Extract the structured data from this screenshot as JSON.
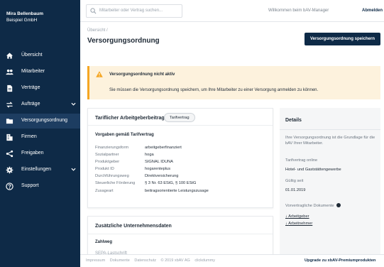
{
  "org": {
    "name": "Mira Bellenbaum",
    "company": "Beispiel GmbH"
  },
  "nav": [
    {
      "label": "Übersicht",
      "icon": "home-icon"
    },
    {
      "label": "Mitarbeiter",
      "icon": "users-icon"
    },
    {
      "label": "Verträge",
      "icon": "document-icon"
    },
    {
      "label": "Aufträge",
      "icon": "transfer-icon",
      "expandable": true
    },
    {
      "label": "Versorgungsordnung",
      "icon": "folder-icon",
      "active": true
    },
    {
      "label": "Firmen",
      "icon": "building-icon"
    },
    {
      "label": "Freigaben",
      "icon": "share-icon"
    },
    {
      "label": "Einstellungen",
      "icon": "gear-icon",
      "expandable": true
    },
    {
      "label": "Support",
      "icon": "help-icon"
    }
  ],
  "topbar": {
    "search_placeholder": "Mitarbeiter oder Vertrag suchen...",
    "welcome": "Willkommen beim bAV-Manager",
    "logout": "Abmelden"
  },
  "page": {
    "breadcrumb": "Übersicht /",
    "title": "Versorgungsordnung",
    "save_label": "Versorgungsordnung speichern"
  },
  "alert": {
    "title": "Versorgungsordnung nicht aktiv",
    "message": "Sie müssen die Versorgungsordnung speichern, um Ihre Mitarbeiter zu einer Versorgung anmelden zu können."
  },
  "tariff_card": {
    "title": "Tariflicher Arbeitgeberbeitrag",
    "chip": "Tarifvertrag",
    "subheading": "Vorgaben gemäß Tarifvertrag",
    "rows": [
      {
        "key": "Finanzierungsform",
        "value": "arbeitgeberfinanziert"
      },
      {
        "key": "Sozialpartner",
        "value": "hoga"
      },
      {
        "key": "Produktgeber",
        "value": "SIGNAL IDUNA"
      },
      {
        "key": "Produkt ID",
        "value": "hogarenteplus"
      },
      {
        "key": "Durchführungsweg",
        "value": "Direktversicherung"
      },
      {
        "key": "Steuerliche Förderung",
        "value": "§ 3 Nr. 63 EStG, § 100 EStG"
      },
      {
        "key": "Zusageart",
        "value": "beitragsorientierte Leistungszusage"
      }
    ]
  },
  "company_card": {
    "title": "Zusätzliche Unternehmensdaten",
    "subheading": "Zahlweg",
    "partial": "SEPA-Lastschrift"
  },
  "details": {
    "title": "Details",
    "description": "Ihre Versorgungsordnung ist die Grundlage für die bAV Ihrer Mitarbeiter.",
    "tariff_label": "Tarifvertrag online",
    "tariff_value": "Hotel- und Gaststättengewerbe",
    "valid_label": "Gültig seit",
    "valid_value": "01.01.2019",
    "docs_label": "Vorvertragliche Dokumente",
    "doc1": "Arbeitgeber",
    "doc2": "Arbeitnehmer"
  },
  "footer": {
    "links": [
      "Impressum",
      "Dokumente",
      "Datenschutz",
      "© 2019 xbAV AG",
      "clickdummy"
    ],
    "upgrade": "Upgrade zu xbAV-Premiumprodukten"
  },
  "colors": {
    "sidebar": "#0e2a47",
    "active": "#1d3d61",
    "warning": "#f5a623",
    "warning_bg": "#fdf2dd"
  }
}
